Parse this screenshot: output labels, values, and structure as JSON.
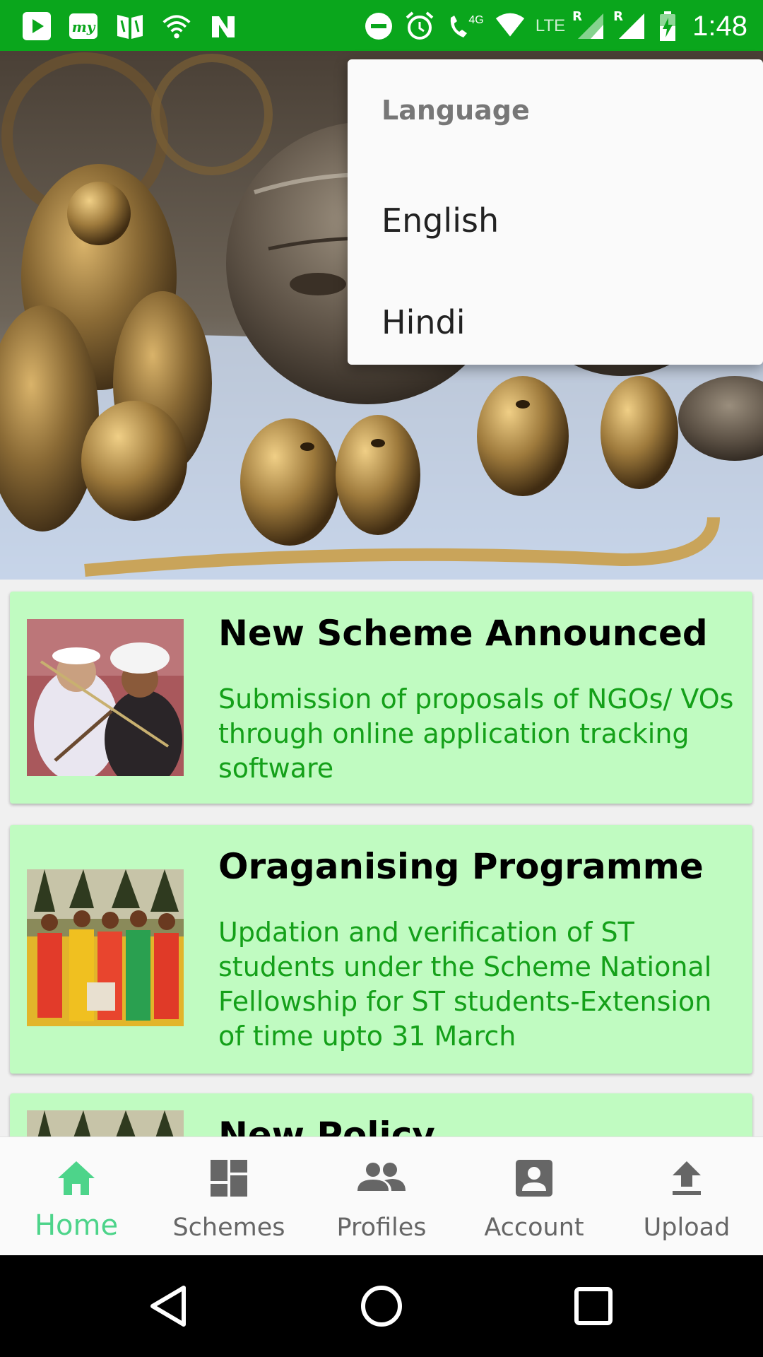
{
  "status_bar": {
    "time": "1:48",
    "network_label": "4G",
    "lte_label": "LTE",
    "roaming_label_1": "R",
    "roaming_label_2": "R",
    "background_color": "#0aa61c"
  },
  "menu": {
    "header": "Language",
    "items": [
      "English",
      "Hindi"
    ]
  },
  "cards": [
    {
      "title": "New Scheme Announced",
      "body": "Submission of proposals of NGOs/ VOs through online application tracking software"
    },
    {
      "title": "Oraganising Programme",
      "body": "Updation and verification of ST students under the Scheme National Fellowship for ST students-Extension of time upto 31 March"
    },
    {
      "title": "New Policy",
      "body": ""
    }
  ],
  "bottom_nav": {
    "items": [
      {
        "label": "Home",
        "icon": "home-icon",
        "active": true
      },
      {
        "label": "Schemes",
        "icon": "dashboard-icon",
        "active": false
      },
      {
        "label": "Profiles",
        "icon": "people-icon",
        "active": false
      },
      {
        "label": "Account",
        "icon": "account-box-icon",
        "active": false
      },
      {
        "label": "Upload",
        "icon": "upload-icon",
        "active": false
      }
    ],
    "active_color": "#4dd48a",
    "inactive_color": "#666666"
  },
  "colors": {
    "card_background": "#c0fbc1",
    "card_text_green": "#14a019"
  }
}
